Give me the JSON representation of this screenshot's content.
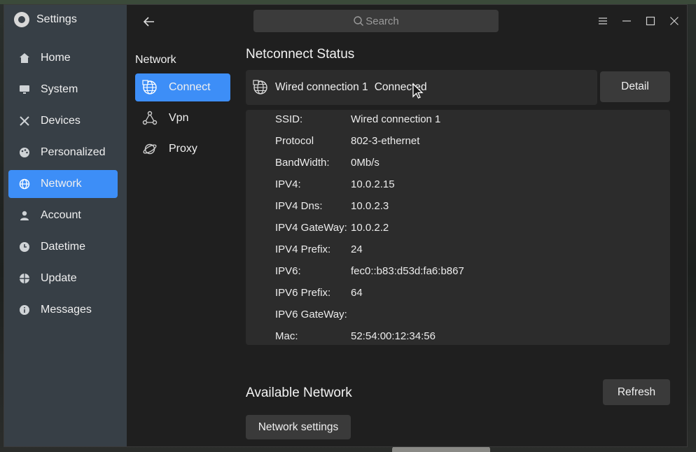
{
  "app": {
    "title": "Settings"
  },
  "nav": {
    "items": [
      {
        "label": "Home",
        "icon": "home-icon"
      },
      {
        "label": "System",
        "icon": "monitor-icon"
      },
      {
        "label": "Devices",
        "icon": "devices-icon"
      },
      {
        "label": "Personalized",
        "icon": "palette-icon"
      },
      {
        "label": "Network",
        "icon": "globe-icon",
        "active": true
      },
      {
        "label": "Account",
        "icon": "user-icon"
      },
      {
        "label": "Datetime",
        "icon": "clock-icon"
      },
      {
        "label": "Update",
        "icon": "update-icon"
      },
      {
        "label": "Messages",
        "icon": "info-icon"
      }
    ]
  },
  "subnav": {
    "title": "Network",
    "items": [
      {
        "label": "Connect",
        "icon": "ethernet-globe-icon",
        "active": true
      },
      {
        "label": "Vpn",
        "icon": "vpn-nodes-icon"
      },
      {
        "label": "Proxy",
        "icon": "planet-icon"
      }
    ]
  },
  "search": {
    "placeholder": "Search"
  },
  "status": {
    "heading": "Netconnect Status",
    "connection_name": "Wired connection 1",
    "connection_state": "Connected",
    "detail_label": "Detail"
  },
  "details": [
    {
      "key": "SSID:",
      "value": "Wired connection 1"
    },
    {
      "key": "Protocol",
      "value": "802-3-ethernet"
    },
    {
      "key": "BandWidth:",
      "value": "0Mb/s"
    },
    {
      "key": "IPV4:",
      "value": "10.0.2.15"
    },
    {
      "key": "IPV4 Dns:",
      "value": "10.0.2.3"
    },
    {
      "key": "IPV4 GateWay:",
      "value": "10.0.2.2"
    },
    {
      "key": "IPV4 Prefix:",
      "value": "24"
    },
    {
      "key": "IPV6:",
      "value": "fec0::b83:d53d:fa6:b867"
    },
    {
      "key": "IPV6 Prefix:",
      "value": "64"
    },
    {
      "key": "IPV6 GateWay:",
      "value": ""
    },
    {
      "key": "Mac:",
      "value": "52:54:00:12:34:56"
    }
  ],
  "available": {
    "heading": "Available Network",
    "refresh_label": "Refresh",
    "network_settings_label": "Network settings"
  },
  "colors": {
    "accent": "#3d8ef7",
    "panel": "#2c2c2c",
    "window": "#1f1f1f"
  }
}
